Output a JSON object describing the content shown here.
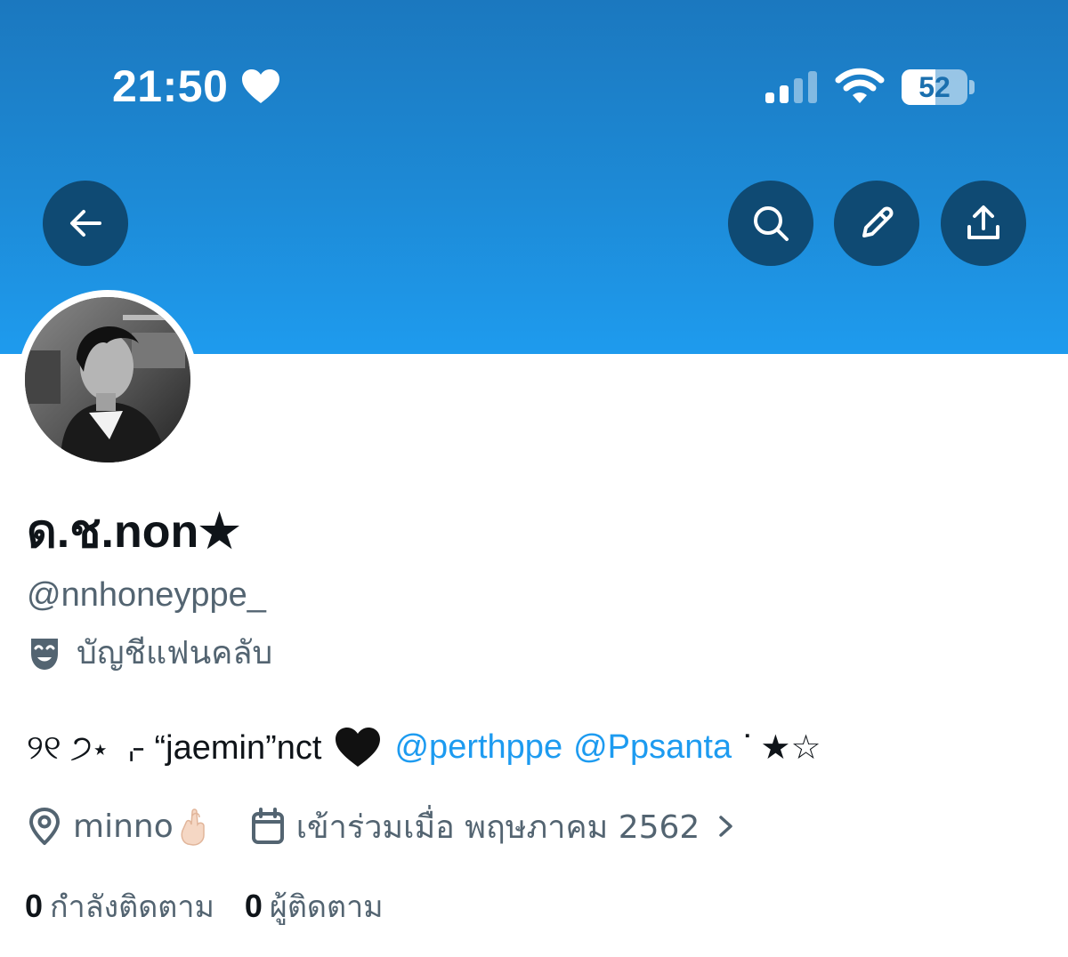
{
  "status_bar": {
    "time": "21:50",
    "battery_level": 52,
    "battery_label": "52"
  },
  "header": {
    "banner_color": "#1d8ad6",
    "button_color": "#0f4a73",
    "back_icon": "arrow-left-icon",
    "search_icon": "search-icon",
    "edit_icon": "pencil-icon",
    "share_icon": "share-icon"
  },
  "profile": {
    "display_name": "ด.ช.non★",
    "handle": "@nnhoneyppe_",
    "account_type_label": "บัญชีแฟนคลับ",
    "bio": {
      "prefix": "୨୧ ੭⋆ ⌌ “jaemin”nct",
      "heart_icon": "black-heart-icon",
      "mention_1": "@perthppe",
      "mention_2": "@Ppsanta",
      "suffix": "ᐝ ★☆"
    },
    "location": "minno",
    "joined": "เข้าร่วมเมื่อ พฤษภาคม 2562",
    "following_count": "0",
    "following_label": "กำลังติดตาม",
    "followers_count": "0",
    "followers_label": "ผู้ติดตาม"
  },
  "colors": {
    "link": "#1d9bf0",
    "secondary_text": "#536471",
    "primary_text": "#0f1419"
  }
}
